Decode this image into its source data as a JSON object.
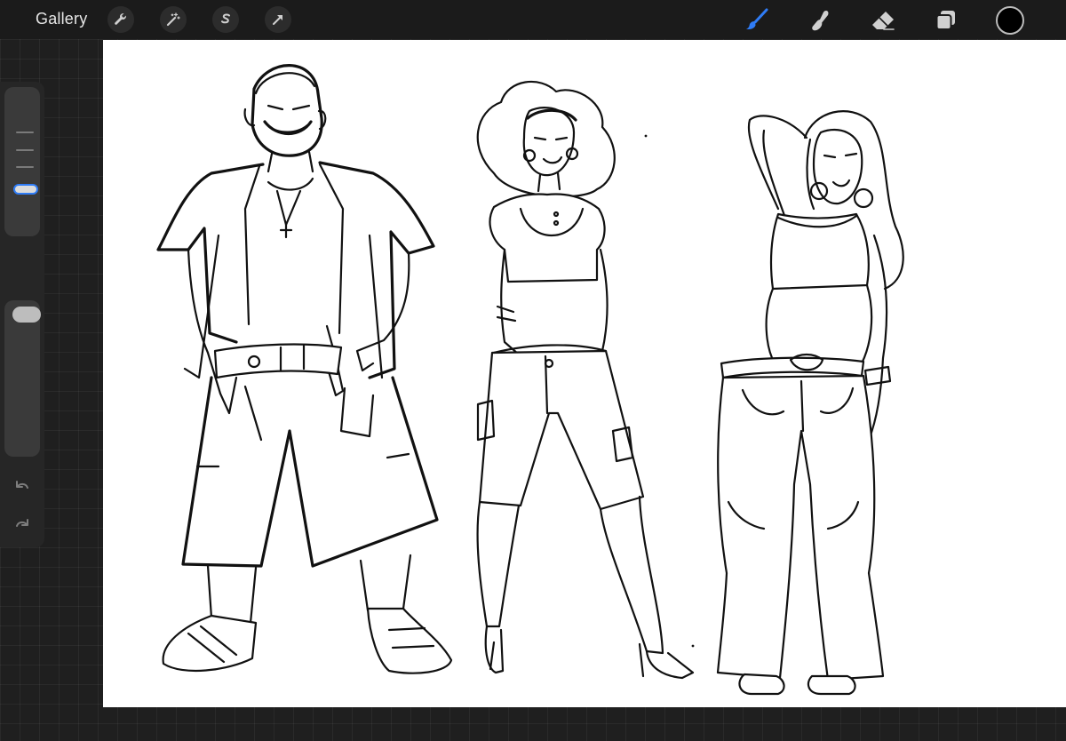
{
  "topbar": {
    "gallery_label": "Gallery",
    "left_tools": [
      {
        "name": "actions",
        "icon": "wrench-icon"
      },
      {
        "name": "adjustments",
        "icon": "magic-wand-icon"
      },
      {
        "name": "selection",
        "icon": "selection-s-icon"
      },
      {
        "name": "transform",
        "icon": "arrow-cursor-icon"
      }
    ],
    "right_tools": [
      {
        "name": "brush",
        "icon": "brush-icon",
        "active": true
      },
      {
        "name": "smudge",
        "icon": "smudge-finger-icon",
        "active": false
      },
      {
        "name": "eraser",
        "icon": "eraser-icon",
        "active": false
      },
      {
        "name": "layers",
        "icon": "layers-icon",
        "active": false
      }
    ],
    "current_color": "#000000"
  },
  "sidebar": {
    "brush_size_level": 0.28,
    "brush_opacity_level": 1.0,
    "modify_icon": "square-icon",
    "undo_icon": "undo-arrow-icon",
    "redo_icon": "redo-arrow-icon"
  },
  "canvas": {
    "background": "#ffffff",
    "artwork": "three-character-lineart"
  },
  "colors": {
    "accent": "#2f7cf6",
    "chrome": "#1b1b1b",
    "icon": "#d0d0d0"
  }
}
